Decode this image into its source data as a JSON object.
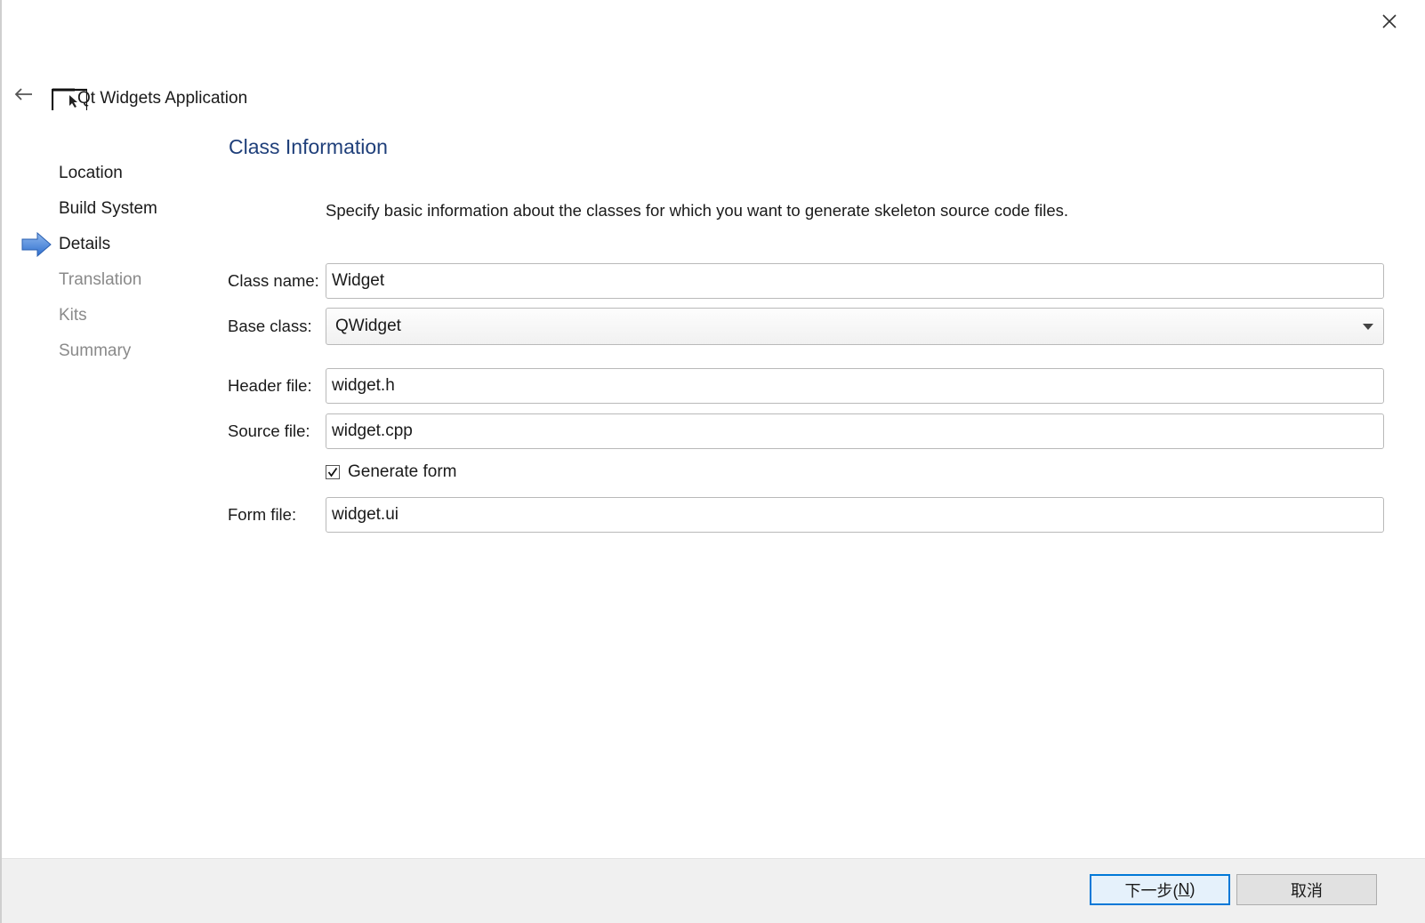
{
  "window": {
    "wizard_title": "Qt Widgets Application"
  },
  "steps": [
    {
      "label": "Location",
      "state": "done"
    },
    {
      "label": "Build System",
      "state": "done"
    },
    {
      "label": "Details",
      "state": "current"
    },
    {
      "label": "Translation",
      "state": "future"
    },
    {
      "label": "Kits",
      "state": "future"
    },
    {
      "label": "Summary",
      "state": "future"
    }
  ],
  "page": {
    "title": "Class Information",
    "description": "Specify basic information about the classes for which you want to generate skeleton source code files."
  },
  "form": {
    "class_name": {
      "label": "Class name:",
      "value": "Widget"
    },
    "base_class": {
      "label": "Base class:",
      "value": "QWidget"
    },
    "header_file": {
      "label": "Header file:",
      "value": "widget.h"
    },
    "source_file": {
      "label": "Source file:",
      "value": "widget.cpp"
    },
    "generate_form": {
      "label": "Generate form",
      "checked": true
    },
    "form_file": {
      "label": "Form file:",
      "value": "widget.ui"
    }
  },
  "buttons": {
    "next_prefix": "下一步(",
    "next_mnemonic": "N",
    "next_suffix": ")",
    "cancel": "取消"
  },
  "colors": {
    "title_blue": "#1f3f7a",
    "step_arrow": "#3a7bd5",
    "default_button_border": "#0078d7"
  },
  "icons": {
    "close": "close-icon",
    "back": "back-arrow-icon",
    "app": "qt-widgets-app-icon",
    "current_step": "current-step-arrow-icon",
    "dropdown": "chevron-down-icon",
    "check": "checkmark-icon"
  }
}
